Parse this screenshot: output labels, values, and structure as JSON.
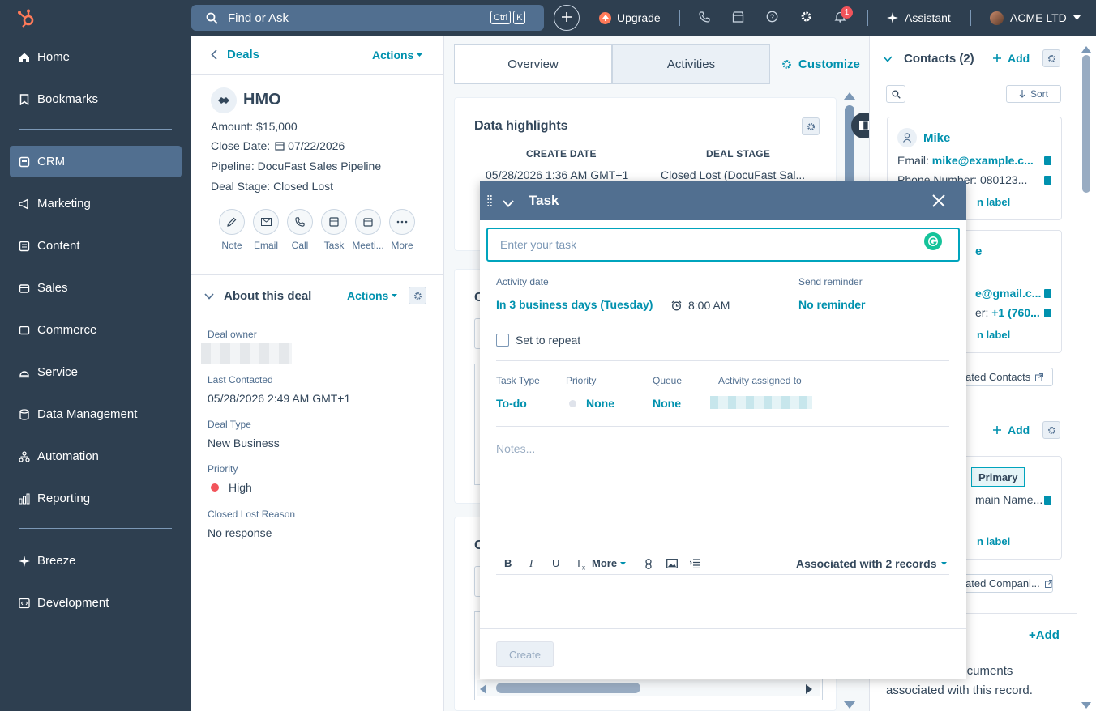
{
  "topbar": {
    "search_placeholder": "Find or Ask",
    "kbd_ctrl": "Ctrl",
    "kbd_k": "K",
    "upgrade": "Upgrade",
    "assistant": "Assistant",
    "account": "ACME LTD",
    "notifications": "1"
  },
  "sidebar": {
    "items": [
      {
        "label": "Home",
        "icon": "home-icon"
      },
      {
        "label": "Bookmarks",
        "icon": "bookmark-icon"
      },
      {
        "label": "CRM",
        "icon": "crm-icon"
      },
      {
        "label": "Marketing",
        "icon": "megaphone-icon"
      },
      {
        "label": "Content",
        "icon": "content-icon"
      },
      {
        "label": "Sales",
        "icon": "sales-icon"
      },
      {
        "label": "Commerce",
        "icon": "commerce-icon"
      },
      {
        "label": "Service",
        "icon": "service-icon"
      },
      {
        "label": "Data Management",
        "icon": "database-icon"
      },
      {
        "label": "Automation",
        "icon": "automation-icon"
      },
      {
        "label": "Reporting",
        "icon": "reporting-icon"
      },
      {
        "label": "Breeze",
        "icon": "breeze-icon"
      },
      {
        "label": "Development",
        "icon": "code-icon"
      }
    ]
  },
  "deal": {
    "back_label": "Deals",
    "actions": "Actions",
    "name": "HMO",
    "amount_label": "Amount:",
    "amount": "$15,000",
    "close_date_label": "Close Date:",
    "close_date": "07/22/2026",
    "pipeline_label": "Pipeline:",
    "pipeline": "DocuFast Sales Pipeline",
    "stage_label": "Deal Stage:",
    "stage": "Closed Lost",
    "action_buttons": [
      "Note",
      "Email",
      "Call",
      "Task",
      "Meeti...",
      "More"
    ]
  },
  "about": {
    "title": "About this deal",
    "actions": "Actions",
    "owner_label": "Deal owner",
    "last_contacted_label": "Last Contacted",
    "last_contacted": "05/28/2026 2:49 AM GMT+1",
    "deal_type_label": "Deal Type",
    "deal_type": "New Business",
    "priority_label": "Priority",
    "priority": "High",
    "lost_reason_label": "Closed Lost Reason",
    "lost_reason": "No response"
  },
  "middle": {
    "tabs": [
      "Overview",
      "Activities"
    ],
    "customize": "Customize",
    "highlights_title": "Data highlights",
    "create_date_header": "CREATE DATE",
    "create_date": "05/28/2026 1:36 AM GMT+1",
    "deal_stage_header": "DEAL STAGE",
    "deal_stage": "Closed Lost (DocuFast Sal...",
    "card2_initial": "C",
    "card3_initial": "C"
  },
  "right": {
    "contacts_title": "Contacts (2)",
    "add": "Add",
    "sort": "Sort",
    "contact1_name": "Mike",
    "email_label": "Email:",
    "contact1_email": "mike@example.c...",
    "phone_label": "Phone Number:",
    "contact1_phone": "080123...",
    "assoc_label_1": "n label",
    "contact2_name_partial": "e",
    "contact2_email_partial": "e@gmail.c...",
    "contact2_phone_label_partial": "er:",
    "contact2_phone": "+1 (760...",
    "assoc_label_2": "n label",
    "view_contacts": "ated Contacts",
    "add2": "Add",
    "primary": "Primary",
    "domain_partial": "main Name...",
    "assoc_label_3": "n label",
    "view_companies": "ated Compani...",
    "add3": "+Add",
    "docs_text_1": "documents",
    "docs_text_2": "associated with this record."
  },
  "task": {
    "title": "Task",
    "task_placeholder": "Enter your task",
    "activity_date_label": "Activity date",
    "activity_date": "In 3 business days (Tuesday)",
    "time": "8:00 AM",
    "send_reminder_label": "Send reminder",
    "reminder": "No reminder",
    "repeat_label": "Set to repeat",
    "task_type_label": "Task Type",
    "task_type": "To-do",
    "priority_label": "Priority",
    "priority": "None",
    "queue_label": "Queue",
    "queue": "None",
    "assigned_label": "Activity assigned to",
    "notes_placeholder": "Notes...",
    "more": "More",
    "associated": "Associated with 2 records",
    "create": "Create"
  },
  "colors": {
    "sidebar": "#2e3f50",
    "active": "#516f90",
    "accent": "#0091ae",
    "modal_header": "#516f90",
    "priority_high": "#f2545b"
  }
}
